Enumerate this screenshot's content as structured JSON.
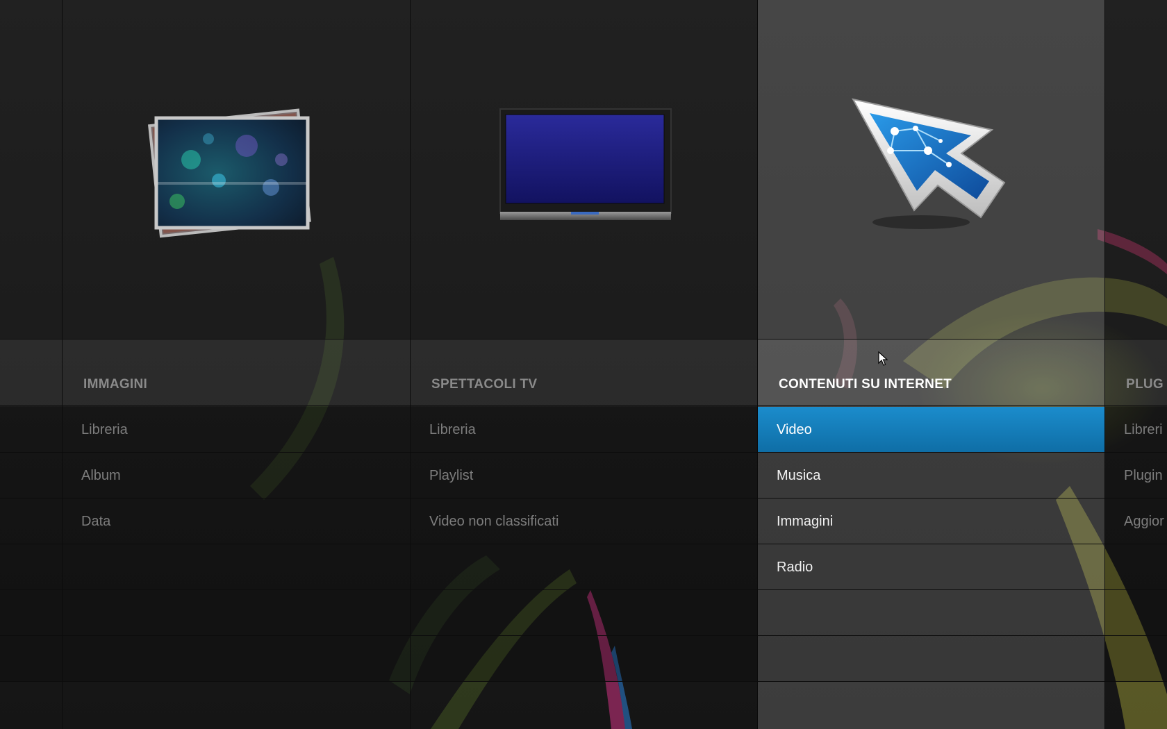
{
  "columns": [
    {
      "title": "IMMAGINI",
      "icon": "photo-stack-icon",
      "items": [
        "Libreria",
        "Album",
        "Data"
      ]
    },
    {
      "title": "SPETTACOLI TV",
      "icon": "tv-icon",
      "items": [
        "Libreria",
        "Playlist",
        "Video non classificati"
      ]
    },
    {
      "title": "CONTENUTI SU INTERNET",
      "icon": "network-cursor-icon",
      "items": [
        "Video",
        "Musica",
        "Immagini",
        "Radio"
      ],
      "selected_item": "Video"
    },
    {
      "title": "PLUG",
      "icon": "",
      "items": [
        "Libreri",
        "Plugin",
        "Aggior"
      ]
    }
  ],
  "colors": {
    "background": "#1c1c1c",
    "selection": "#1b8ccc",
    "active_column": "#4a4a4a",
    "inactive_text": "#7d7d7d",
    "active_text": "#ffffff"
  }
}
